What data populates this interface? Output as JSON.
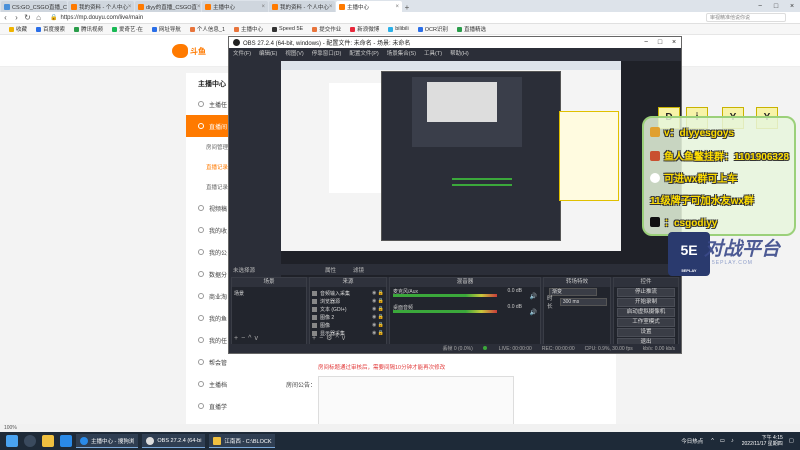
{
  "browser": {
    "tabs": [
      {
        "label": "CS:GO_CSGO直播_CS",
        "active": false
      },
      {
        "label": "我的资料 - 个人中心",
        "active": false
      },
      {
        "label": "diyy的直播_CSGO直",
        "active": false
      },
      {
        "label": "主播中心",
        "active": false
      },
      {
        "label": "我的资料 - 个人中心",
        "active": false
      },
      {
        "label": "主播中心",
        "active": true
      }
    ],
    "url": "https://mp.douyu.com/live/main",
    "search_placeholder": "审视精准他说你说",
    "bookmarks": [
      "收藏",
      "百度搜索",
      "腾讯视频",
      "爱奇艺·在",
      "网址导航",
      "个人信息_1",
      "主播中心",
      "Speed 5E",
      "提交作业",
      "新浪微博",
      "bilibili",
      "OCR识别",
      "直播精选"
    ]
  },
  "site": {
    "logo_text": "斗鱼",
    "sidebar_title": "主播中心",
    "sidebar_items": [
      {
        "label": "主播任",
        "type": "item"
      },
      {
        "label": "直播间",
        "type": "active"
      },
      {
        "label": "房间管理",
        "type": "sub"
      },
      {
        "label": "直播记录",
        "type": "sub-hl"
      },
      {
        "label": "直播记录",
        "type": "sub"
      },
      {
        "label": "视频稿",
        "type": "item"
      },
      {
        "label": "我的收",
        "type": "item"
      },
      {
        "label": "我的公",
        "type": "item"
      },
      {
        "label": "数据分",
        "type": "item"
      },
      {
        "label": "商业淘",
        "type": "item"
      },
      {
        "label": "我的鱼",
        "type": "item"
      },
      {
        "label": "我的任",
        "type": "item"
      },
      {
        "label": "帮会管",
        "type": "item"
      },
      {
        "label": "主播档",
        "type": "item"
      },
      {
        "label": "直播学",
        "type": "item"
      }
    ],
    "red_note": "房间标题通过审核后，需要间隔10分钟才能再次修改",
    "room_label": "房间公告："
  },
  "obs": {
    "title": "OBS 27.2.4 (64-bit, windows) - 配置文件: 未命名 - 场景: 未命名",
    "menu": [
      "文件(F)",
      "编辑(E)",
      "视图(V)",
      "停靠窗口(D)",
      "配置文件(P)",
      "场景集合(S)",
      "工具(T)",
      "帮助(H)"
    ],
    "scene_bar": [
      "未选择源",
      "属性",
      "滤镜"
    ],
    "docks": {
      "scenes": {
        "title": "场景",
        "items": [
          "场景"
        ]
      },
      "sources": {
        "title": "来源",
        "items": [
          "音频输入采集",
          "浏览器源",
          "文本 (GDI+)",
          "图像 2",
          "图像",
          "显示器采集"
        ]
      },
      "mixer": {
        "title": "混音器",
        "tracks": [
          {
            "name": "麦克风/Aux",
            "db": "0.0 dB"
          },
          {
            "name": "桌面音频",
            "db": "0.0 dB"
          }
        ]
      },
      "transitions": {
        "title": "转场特效",
        "type_value": "渐变",
        "duration_label": "时长",
        "duration_value": "300 ms"
      },
      "controls": {
        "title": "控件",
        "buttons": [
          "停止推流",
          "开始录制",
          "启动虚拟摄像机",
          "工作室模式",
          "设置",
          "退出"
        ]
      }
    },
    "status": {
      "live": "LIVE: 00:00:00",
      "rec": "REC: 00:00:00",
      "cpu": "CPU: 0.9%, 30.00 fps",
      "kbps": "kb/s: 0.00 kb/s",
      "dropped": "丢帧 0 (0.0%)"
    }
  },
  "overlay": {
    "diy_letters": [
      "D",
      "i",
      "Y",
      "Y"
    ],
    "lines": [
      {
        "icon": "key-icon",
        "text": "v：diyyesgoys"
      },
      {
        "icon": "user-icon",
        "text": "鱼人鱼鳖挂群：1101906328"
      },
      {
        "icon": "wechat-icon",
        "text": "可进wx群可上车"
      },
      {
        "icon": "",
        "text": "11级牌子可加水友wx群"
      },
      {
        "icon": "tiktok-icon",
        "text": "：csgodiyy"
      }
    ],
    "badge_text": "5E",
    "badge_sub": "5EPLAY",
    "brand": "对战平台",
    "brand_sub": "5EPLAY.COM"
  },
  "statusbar": {
    "text": "100%"
  },
  "taskbar": {
    "apps": [
      {
        "label": "主播中心 - 搜狗浏"
      },
      {
        "label": "OBS 27.2.4 (64-bi"
      },
      {
        "label": "江南西 - C:\\BLOCK"
      }
    ],
    "news": "今日热点",
    "time": "下午 4:15",
    "date": "2022/11/17 星期四"
  },
  "colors": {
    "accent": "#ff7a00",
    "obs_bg": "#2b2e38",
    "overlay_text": "#ffde00"
  }
}
